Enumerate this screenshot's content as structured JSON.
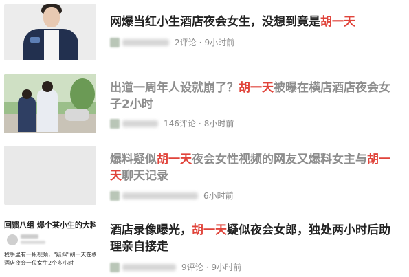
{
  "accent_color": "#e0443b",
  "items": [
    {
      "title_parts": [
        "网爆当红小生酒店夜会女生，没想到竟是",
        "胡一天"
      ],
      "read": false,
      "comments": "2评论",
      "time": "9小时前"
    },
    {
      "title_parts": [
        "出道一周年人设就崩了？",
        "胡一天",
        "被曝在横店酒店夜会女子2小时"
      ],
      "read": true,
      "comments": "146评论",
      "time": "8小时前"
    },
    {
      "title_parts": [
        "爆料疑似",
        "胡一天",
        "夜会女性视频的网友又爆料女主与",
        "胡一天",
        "聊天记录"
      ],
      "read": true,
      "comments": "",
      "time": "6小时前"
    },
    {
      "title_parts": [
        "酒店录像曝光，",
        "胡一天",
        "疑似夜会女郎，独处两小时后助理亲自接走"
      ],
      "read": false,
      "comments": "9评论",
      "time": "9小时前"
    }
  ],
  "thumb4": {
    "headline": "回馈八组 爆个某小生的大料",
    "snippet_line1": "我手里有一段视频，\"疑似\"胡一天在横店",
    "snippet_line2": "酒店夜会一位女生2个多小时"
  },
  "icons": [
    "source-avatar-icon"
  ]
}
